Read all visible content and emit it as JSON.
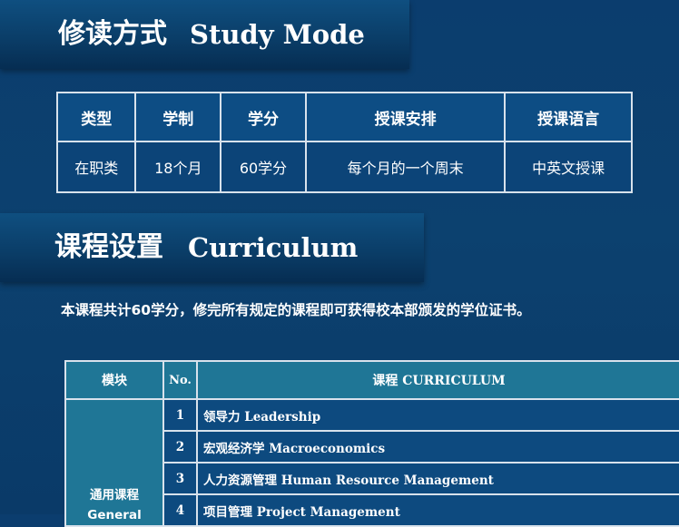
{
  "study_mode": {
    "title_cn": "修读方式",
    "title_en": "Study Mode",
    "headers": [
      "类型",
      "学制",
      "学分",
      "授课安排",
      "授课语言"
    ],
    "row": [
      "在职类",
      "18个月",
      "60学分",
      "每个月的一个周末",
      "中英文授课"
    ]
  },
  "curriculum": {
    "title_cn": "课程设置",
    "title_en": "Curriculum",
    "note": "本课程共计60学分，修完所有规定的课程即可获得校本部颁发的学位证书。",
    "header_module": "模块",
    "header_no": "No.",
    "header_course_cn": "课程",
    "header_course_en": "CURRICULUM",
    "module_cn": "通用课程",
    "module_en": "General",
    "courses": [
      {
        "no": "1",
        "cn": "领导力",
        "en": "Leadership"
      },
      {
        "no": "2",
        "cn": "宏观经济学",
        "en": "Macroeconomics"
      },
      {
        "no": "3",
        "cn": "人力资源管理",
        "en": "Human Resource Management"
      },
      {
        "no": "4",
        "cn": "项目管理",
        "en": "Project Management"
      }
    ]
  }
}
